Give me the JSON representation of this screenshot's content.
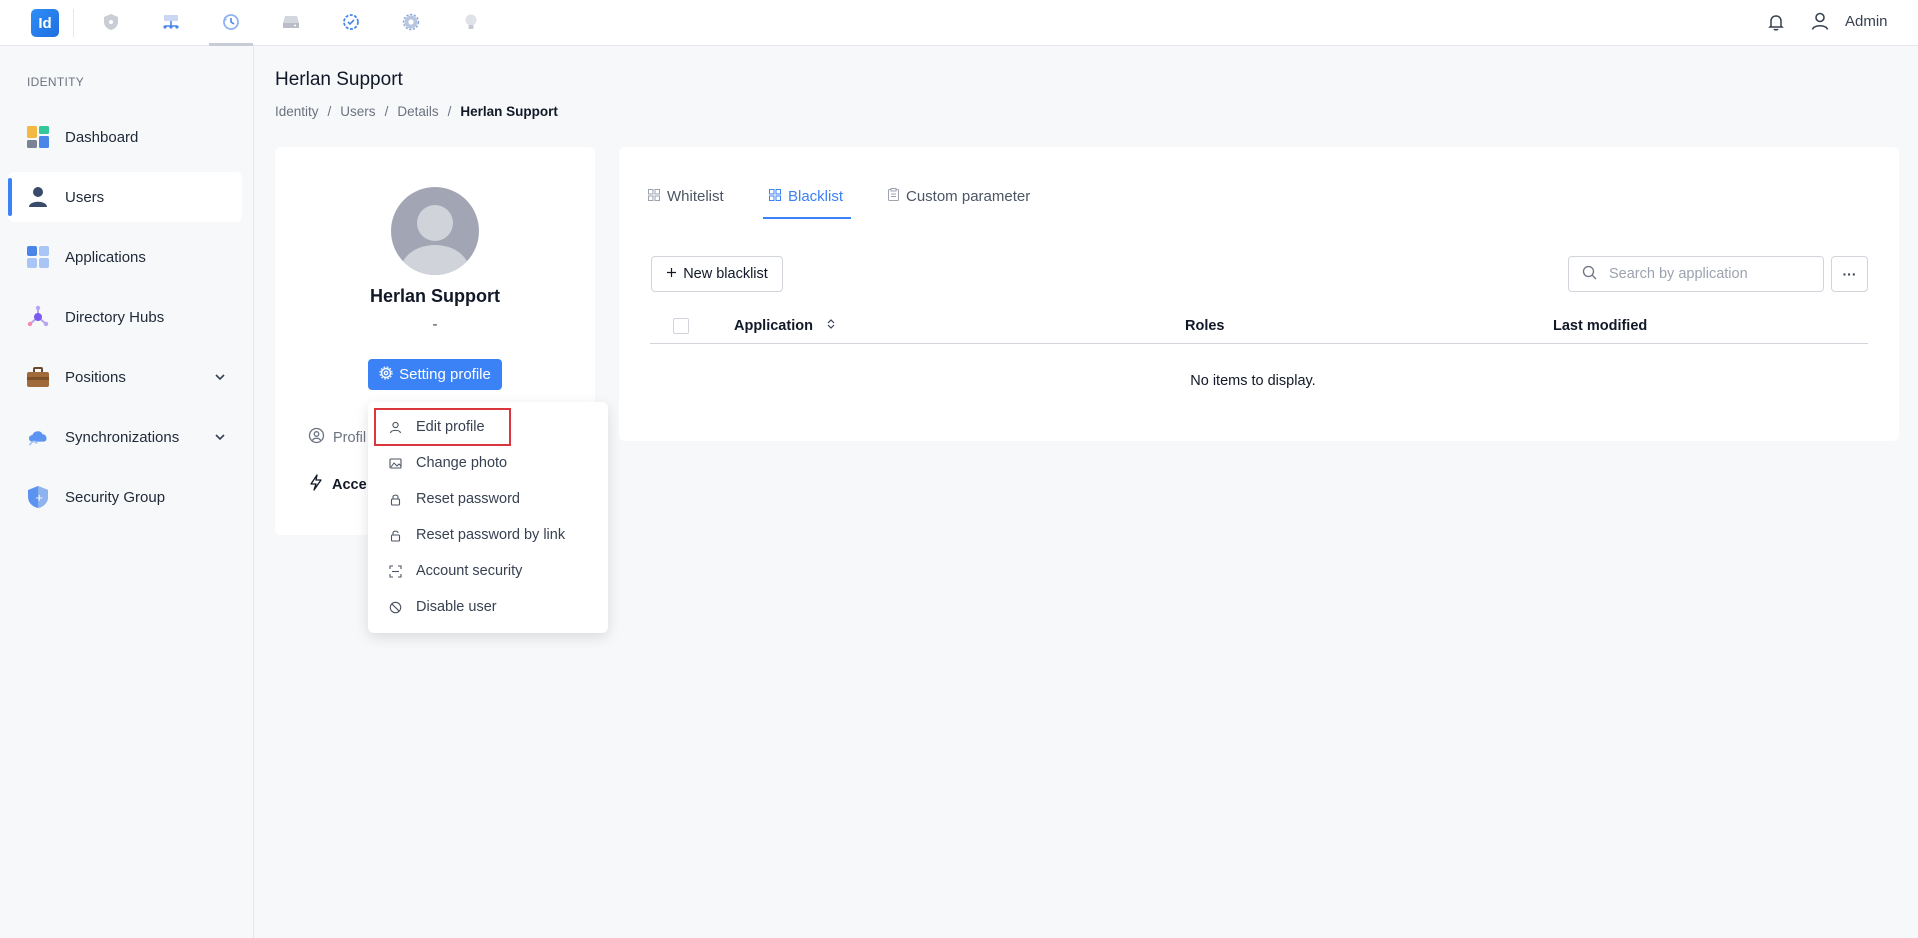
{
  "app": {
    "logo_text": "Id",
    "admin_label": "Admin"
  },
  "top_apps": [
    "shield-app",
    "network-app",
    "history-app",
    "drive-app",
    "check-circle-app",
    "settings-app",
    "bulb-app"
  ],
  "sidebar": {
    "section": "IDENTITY",
    "items": [
      {
        "label": "Dashboard",
        "icon": "dashboard-icon"
      },
      {
        "label": "Users",
        "icon": "user-icon",
        "active": true
      },
      {
        "label": "Applications",
        "icon": "applications-icon"
      },
      {
        "label": "Directory Hubs",
        "icon": "hub-icon"
      },
      {
        "label": "Positions",
        "icon": "briefcase-icon",
        "expandable": true
      },
      {
        "label": "Synchronizations",
        "icon": "cloud-sync-icon",
        "expandable": true
      },
      {
        "label": "Security Group",
        "icon": "shield-icon"
      }
    ]
  },
  "page": {
    "title": "Herlan Support",
    "breadcrumb": [
      "Identity",
      "Users",
      "Details",
      "Herlan Support"
    ],
    "separator": "/"
  },
  "profile": {
    "name": "Herlan Support",
    "subtitle": "-",
    "setting_button": "Setting profile",
    "link_profile": "Profil",
    "link_access": "Acce"
  },
  "dropdown": {
    "items": [
      {
        "label": "Edit profile",
        "icon": "user-icon"
      },
      {
        "label": "Change photo",
        "icon": "image-icon"
      },
      {
        "label": "Reset password",
        "icon": "lock-icon"
      },
      {
        "label": "Reset password by link",
        "icon": "lock-link-icon"
      },
      {
        "label": "Account security",
        "icon": "scan-icon"
      },
      {
        "label": "Disable user",
        "icon": "ban-icon"
      }
    ]
  },
  "tabs": [
    {
      "label": "Whitelist",
      "icon": "grid-icon"
    },
    {
      "label": "Blacklist",
      "icon": "grid-icon",
      "active": true
    },
    {
      "label": "Custom parameter",
      "icon": "clipboard-icon"
    }
  ],
  "toolbar": {
    "new_button": "New blacklist",
    "search_placeholder": "Search by application",
    "more_label": "···"
  },
  "table": {
    "columns": [
      "Application",
      "Roles",
      "Last modified"
    ],
    "empty_text": "No items to display."
  },
  "colors": {
    "accent": "#3b82f6",
    "highlight": "#d9363e"
  }
}
